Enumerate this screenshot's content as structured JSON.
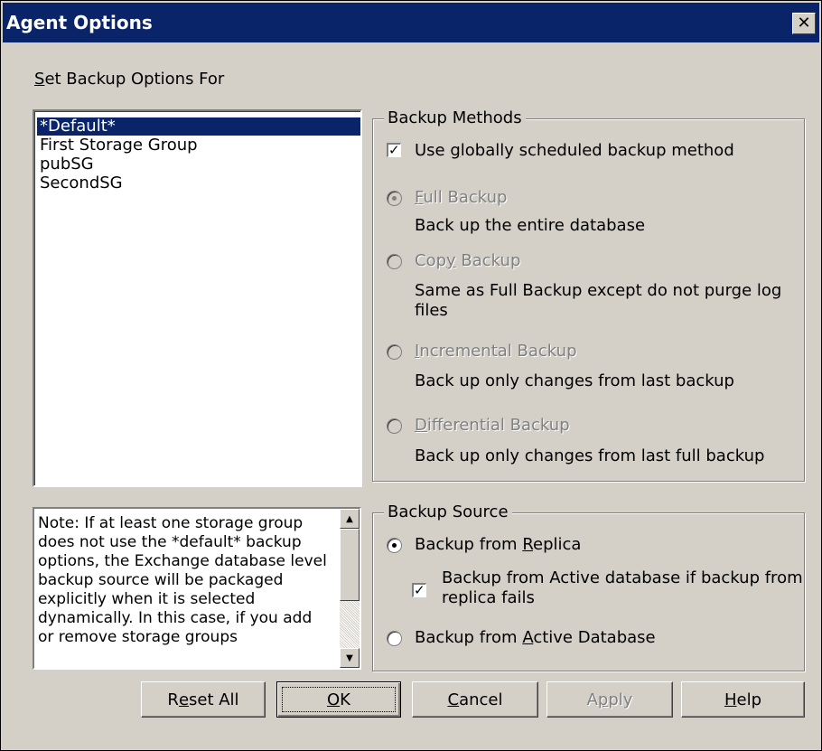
{
  "window": {
    "title": "Agent Options",
    "close_symbol": "✕"
  },
  "set_for": {
    "label": "Set Backup Options For",
    "mnemonic": "S",
    "rest": "et Backup Options For"
  },
  "list": {
    "items": [
      "*Default*",
      "First Storage Group",
      "pubSG",
      "SecondSG"
    ],
    "selected_index": 0
  },
  "backup_methods": {
    "legend": "Backup Methods",
    "use_global": {
      "label_pre": "Use ",
      "mnemonic": "g",
      "label_post": "lobally scheduled backup method",
      "checked": true
    },
    "options": [
      {
        "pre": "",
        "mnemonic": "F",
        "post": "ull Backup",
        "desc": "Back up the entire database",
        "selected": true,
        "enabled": false
      },
      {
        "pre": "Cop",
        "mnemonic": "y",
        "post": " Backup",
        "desc": "Same as Full Backup except do not purge log files",
        "desc_line1": "Same as Full Backup except do not purge log",
        "desc_line2": "files",
        "selected": false,
        "enabled": false
      },
      {
        "pre": "",
        "mnemonic": "I",
        "post": "ncremental Backup",
        "desc": "Back up only changes from last backup",
        "selected": false,
        "enabled": false
      },
      {
        "pre": "",
        "mnemonic": "D",
        "post": "ifferential Backup",
        "desc": "Back up only changes from last full backup",
        "selected": false,
        "enabled": false
      }
    ]
  },
  "backup_source": {
    "legend": "Backup Source",
    "replica": {
      "pre": "Backup from ",
      "mnemonic": "R",
      "post": "eplica",
      "selected": true
    },
    "active_fallback": {
      "line1": "Backup from Active database if backup from",
      "line2": "replica fails",
      "checked": true
    },
    "active": {
      "pre": "Backup from ",
      "mnemonic": "A",
      "post": "ctive Database",
      "selected": false
    }
  },
  "note": {
    "text": "Note: If at least one storage group does not use the *default* backup options, the Exchange database level backup source will be packaged explicitly when it is selected dynamically. In this case, if you add or remove storage groups"
  },
  "buttons": {
    "reset": {
      "pre": "R",
      "mnemonic": "e",
      "post": "set All"
    },
    "ok": {
      "pre": "",
      "mnemonic": "O",
      "post": "K"
    },
    "cancel": {
      "pre": "",
      "mnemonic": "C",
      "post": "ancel"
    },
    "apply": {
      "pre": "A",
      "mnemonic": "p",
      "post": "ply"
    },
    "help": {
      "pre": "",
      "mnemonic": "H",
      "post": "elp"
    }
  }
}
